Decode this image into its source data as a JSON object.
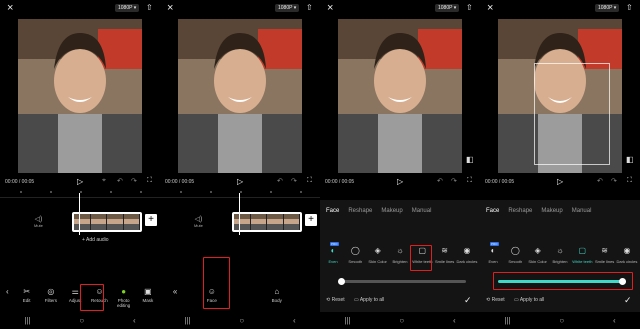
{
  "top": {
    "close_icon": "×",
    "resolution": "1080P ▾",
    "export_icon": "⇧"
  },
  "player": {
    "timecode": "00:00 / 00:05",
    "play_icon": "▷",
    "undo_icon": "↶",
    "redo_icon": "↷",
    "fullscreen_icon": "⛶"
  },
  "timeline": {
    "mute_icon": "◁)",
    "mute_label": "Mute",
    "add_audio": "+ Add audio",
    "add_clip_icon": "+"
  },
  "panel1_toolbar": [
    {
      "icon": "‹",
      "label": ""
    },
    {
      "icon": "✂",
      "label": "Edit"
    },
    {
      "icon": "◎",
      "label": "Filters"
    },
    {
      "icon": "⚌",
      "label": "Adjust"
    },
    {
      "icon": "☺",
      "label": "Retouch"
    },
    {
      "icon": "●",
      "label": "Photo editing"
    },
    {
      "icon": "▣",
      "label": "Mask"
    }
  ],
  "panel2_toolbar": {
    "back_icon": "«",
    "face_icon": "☺",
    "face_label": "Face",
    "body_icon": "⌂",
    "body_label": "Body"
  },
  "retouch_tabs": [
    "Face",
    "Reshape",
    "Makeup",
    "Manual"
  ],
  "features": [
    {
      "icon": "◐",
      "label": "Even"
    },
    {
      "icon": "◯",
      "label": "Smooth"
    },
    {
      "icon": "◈",
      "label": "Skin Color"
    },
    {
      "icon": "☼",
      "label": "Brighten"
    },
    {
      "icon": "▢",
      "label": "White teeth"
    },
    {
      "icon": "≋",
      "label": "Smile lines"
    },
    {
      "icon": "◉",
      "label": "Dark circles"
    }
  ],
  "pro_badge": "PRO",
  "sheet_footer": {
    "reset": "⟲ Reset",
    "apply_all": "▭ Apply to all",
    "confirm_icon": "✓"
  },
  "nav": {
    "recent": "|||",
    "home": "○",
    "back": "‹"
  },
  "slider": {
    "panel3_value": 0.0,
    "panel4_value": 1.0
  },
  "accent_color": "#3fd9c8",
  "highlight_color": "#e02020"
}
